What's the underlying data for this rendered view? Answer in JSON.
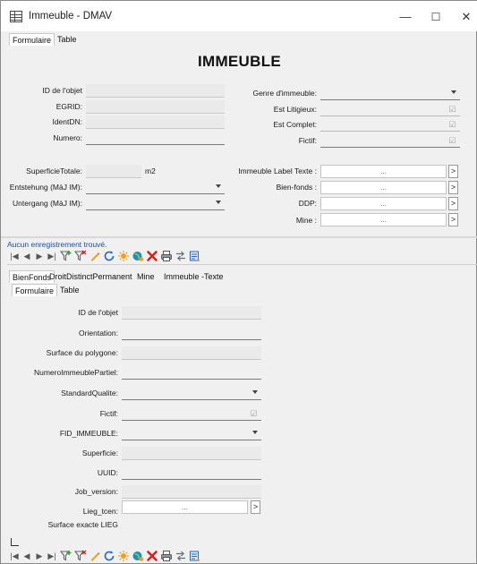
{
  "window": {
    "title": "Immeuble - DMAV",
    "minimize_glyph": "—",
    "maximize_glyph": "☐",
    "close_glyph": "✕"
  },
  "top_tabs": [
    "Formulaire",
    "Table"
  ],
  "heading": "IMMEUBLE",
  "left_fields": {
    "id_objet": "ID de l'objet",
    "egrid": "EGRID:",
    "identdn": "IdentDN:",
    "numero": "Numero:",
    "superficie_totale": "SuperficieTotale:",
    "superficie_unit": "m2",
    "entstehung": "Entstehung (MàJ IM):",
    "untergang": "Untergang (MàJ IM):"
  },
  "right_fields": {
    "genre": "Genre d'immeuble:",
    "est_litigieux": "Est Litigieux:",
    "est_complet": "Est Complet:",
    "fictif": "Fictif:",
    "immeuble_label_texte": "Immeuble Label Texte :",
    "bien_fonds": "Bien-fonds :",
    "ddp": "DDP:",
    "mine": "Mine :"
  },
  "lookup_placeholder": "...",
  "lookup_button": ">",
  "status_text": "Aucun enregistrement trouvé.",
  "nav": {
    "first": "|◀",
    "prev": "◀",
    "next": "▶",
    "last": "▶|"
  },
  "sub_tabs": [
    "BienFonds",
    "DroitDistinctPermanent",
    "Mine",
    "Immeuble -Texte"
  ],
  "sub_inner_tabs": [
    "Formulaire",
    "Table"
  ],
  "sub_fields": {
    "id_objet": "ID de l'objet",
    "orientation": "Orientation:",
    "surface_polygone": "Surface du polygone:",
    "numero_partiel": "NumeroImmeublePartiel:",
    "standard_qualite": "StandardQualite:",
    "fictif": "Fictif:",
    "fid_immeuble": "FID_IMMEUBLE:",
    "superficie": "Superficie:",
    "uuid": "UUID:",
    "job_version": "Job_version:",
    "lieg_tcen": "Lieg_tcen:",
    "surface_exacte": "Surface exacte LIEG"
  },
  "colors": {
    "status_blue": "#1a4db8",
    "filter_green": "#2f9e3a",
    "refresh_blue": "#2a63c8",
    "new_orange": "#f0a020",
    "delete_red": "#d42020",
    "globe_teal": "#1f8fb0"
  },
  "toolbar_icons": [
    "first-record-icon",
    "prev-record-icon",
    "next-record-icon",
    "last-record-icon",
    "filter-add-icon",
    "filter-clear-icon",
    "edit-icon",
    "refresh-icon",
    "new-record-icon",
    "globe-icon",
    "delete-icon",
    "print-icon",
    "transfer-icon",
    "export-icon"
  ]
}
